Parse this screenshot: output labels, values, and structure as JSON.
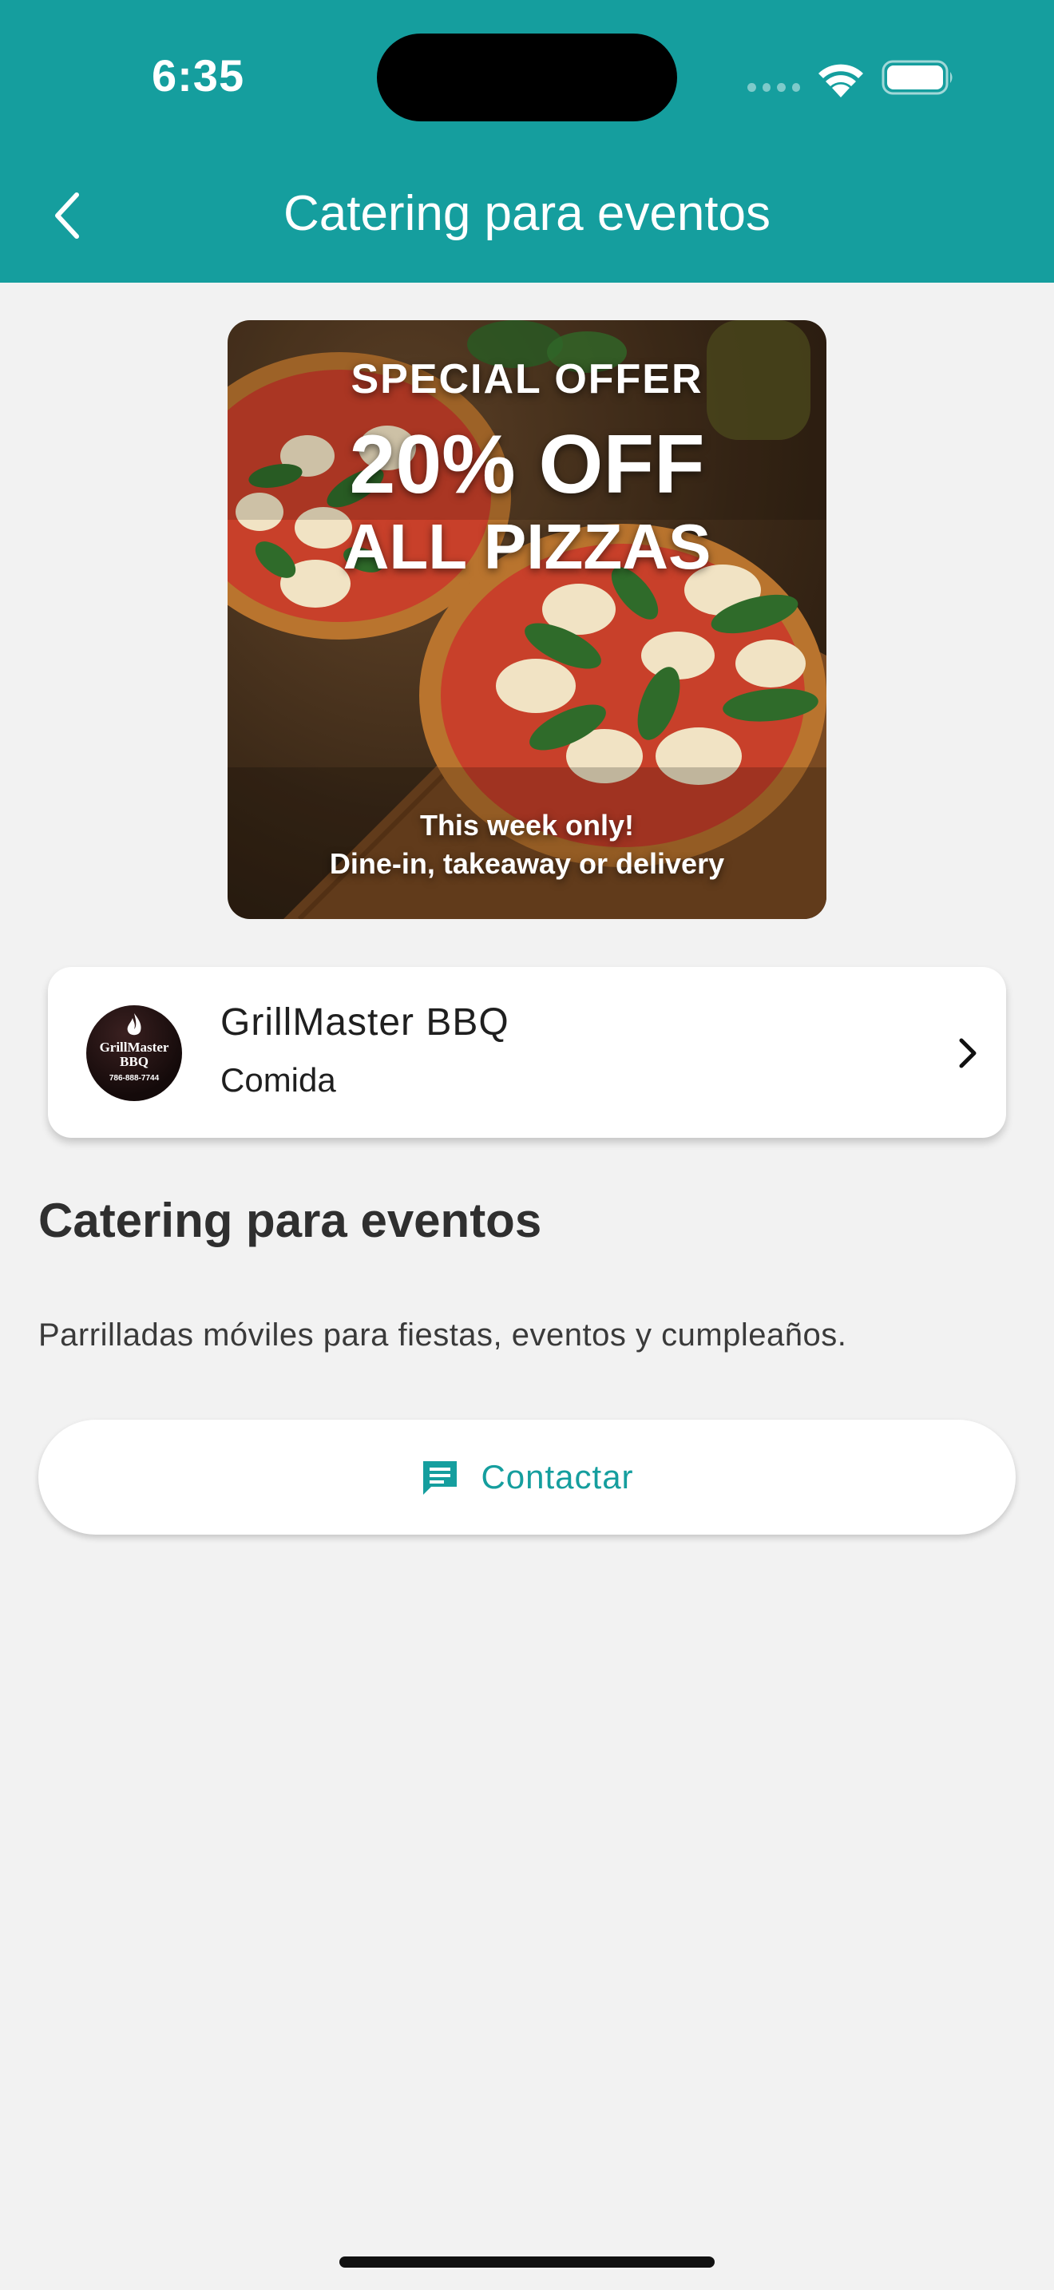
{
  "status_bar": {
    "time": "6:35"
  },
  "header": {
    "title": "Catering para eventos"
  },
  "promo": {
    "kicker": "SPECIAL OFFER",
    "headline": "20% OFF",
    "subheadline": "ALL PIZZAS",
    "note_line1": "This week only!",
    "note_line2": "Dine-in, takeaway or delivery"
  },
  "vendor": {
    "name": "GrillMaster BBQ",
    "category": "Comida",
    "logo_text_line1": "GrillMaster",
    "logo_text_line2": "BBQ",
    "logo_phone": "786-888-7744"
  },
  "content": {
    "title": "Catering para eventos",
    "description": "Parrilladas móviles para fiestas, eventos y cumpleaños."
  },
  "actions": {
    "contact_label": "Contactar"
  },
  "colors": {
    "primary": "#159e9e",
    "background": "#f2f2f2",
    "card": "#ffffff"
  },
  "icons": [
    "back-arrow-icon",
    "wifi-icon",
    "battery-icon",
    "chevron-right-icon",
    "message-icon"
  ]
}
